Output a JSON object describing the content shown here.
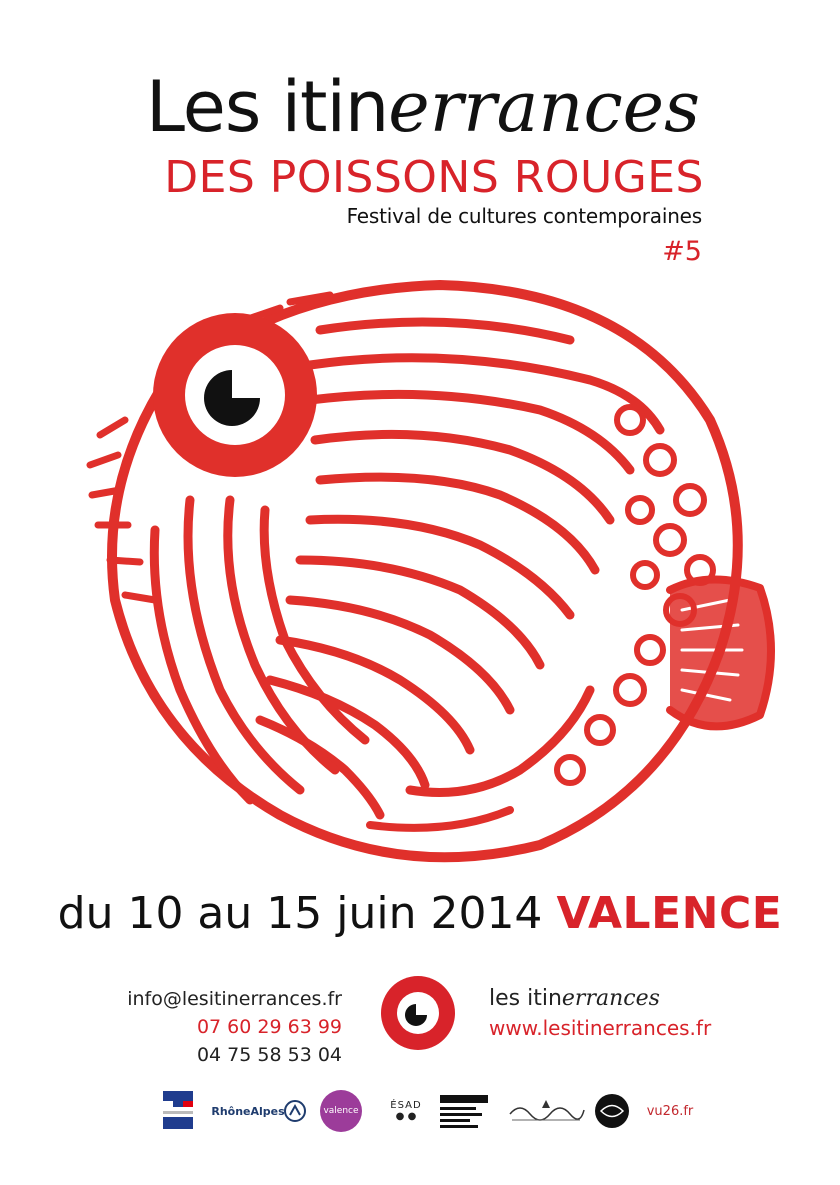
{
  "header": {
    "title_plain": "Les itin",
    "title_italic": "errances",
    "subtitle": "DES POISSONS ROUGES",
    "tagline": "Festival de cultures contemporaines",
    "edition": "#5"
  },
  "event": {
    "dates": "du 10 au 15 juin 2014",
    "city": "VALENCE"
  },
  "contact": {
    "email": "info@lesitinerrances.fr",
    "phone_mobile": "07 60 29 63 99",
    "phone_landline": "04 75 58 53 04"
  },
  "brand": {
    "name_plain": "les itin",
    "name_italic": "errances",
    "url": "www.lesitinerrances.fr"
  },
  "sponsors": {
    "rhone_alpes": "RhôneAlpes",
    "valence": "valence",
    "esad": "ÉSAD",
    "vu26": "vu26.fr"
  },
  "colors": {
    "accent": "#d8232a",
    "ink": "#111111"
  },
  "icons": {
    "fish": "fish-illustration-icon",
    "eye_logo": "eye-logo-icon"
  }
}
